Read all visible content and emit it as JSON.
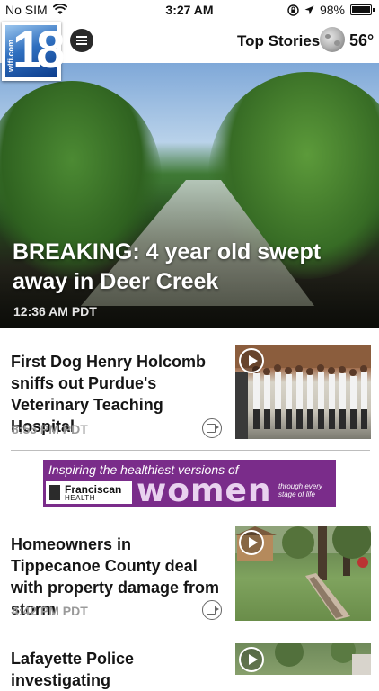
{
  "status_bar": {
    "carrier": "No SIM",
    "time": "3:27 AM",
    "battery": "98%",
    "battery_level": 0.98
  },
  "header": {
    "logo_text": "18",
    "logo_side_text": "wlfi.com",
    "section_title": "Top Stories",
    "weather_icon": "moon-icon",
    "temperature": "56°"
  },
  "hero": {
    "headline": "BREAKING: 4 year old swept away in Deer Creek",
    "time": "12:36 AM PDT"
  },
  "stories": [
    {
      "title": "First Dog Henry Holcomb sniffs out Purdue's Veterinary Teaching Hospital",
      "time": "8:55 PM PDT",
      "has_video": true
    },
    {
      "title": "Homeowners in Tippecanoe County deal with property damage from storm",
      "time": "4:42 PM PDT",
      "has_video": true
    },
    {
      "title": "Lafayette Police investigating",
      "time": "",
      "has_video": true
    }
  ],
  "ad": {
    "tagline": "Inspiring the healthiest versions of",
    "brand_name": "Franciscan",
    "brand_sub": "HEALTH",
    "headline": "women",
    "small_text": "through every stage of life"
  }
}
